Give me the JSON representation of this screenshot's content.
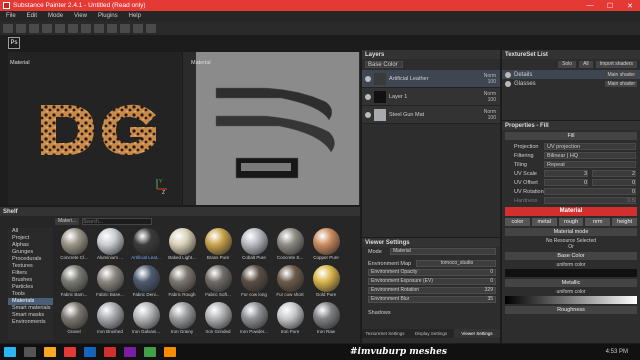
{
  "window": {
    "title": "Substance Painter 2.4.1 - Untitled (Read only)",
    "min": "—",
    "max": "☐",
    "close": "✕"
  },
  "menu": [
    "File",
    "Edit",
    "Mode",
    "View",
    "Plugins",
    "Help"
  ],
  "viewports": {
    "left_label": "Material",
    "right_label": "Material",
    "gizmo_y": "Y",
    "gizmo_z": "Z"
  },
  "layers": {
    "title": "Layers",
    "channel": "Base Color",
    "items": [
      {
        "name": "Artificial Leather",
        "blend": "Norm",
        "opacity": "100"
      },
      {
        "name": "Layer 1",
        "blend": "Norm",
        "opacity": "100"
      },
      {
        "name": "Steel Gun Mat",
        "blend": "Norm",
        "opacity": "100"
      }
    ]
  },
  "textureset": {
    "title": "TextureSet List",
    "solo": "Solo",
    "all": "All",
    "import": "Import shaders",
    "items": [
      {
        "name": "Details",
        "shader": "Main shader"
      },
      {
        "name": "Glasses",
        "shader": "Main shader"
      }
    ]
  },
  "properties": {
    "title": "Properties - Fill",
    "fill": "Fill",
    "projection_label": "Projection",
    "projection": "UV projection",
    "filtering_label": "Filtering",
    "filtering": "Bilinear | HQ",
    "tiling_label": "Tiling",
    "tiling": "Repeat",
    "uvscale_label": "UV Scale",
    "uvscale": "3",
    "uvscale2": "2",
    "uvoffset_label": "UV Offset",
    "uvoffset": "0",
    "uvoffset2": "0",
    "uvrotation_label": "UV Rotation",
    "uvrotation": "0",
    "hardness_label": "Hardness",
    "hardness": "0.5",
    "material": "Material",
    "chips": [
      "color",
      "metal",
      "rough",
      "nrm",
      "height"
    ],
    "material_mode": "Material mode",
    "no_resource": "No Resource Selected",
    "or": "Or",
    "base_color": "Base Color",
    "uniform1": "uniform color",
    "metallic": "Metallic",
    "uniform2": "uniform color",
    "roughness": "Roughness"
  },
  "shelf": {
    "title": "Shelf",
    "filter": "Materi...",
    "search_placeholder": "Search...",
    "categories": [
      "All",
      "Project",
      "Alphas",
      "Grunges",
      "Procedurals",
      "Textures",
      "Filters",
      "Brushes",
      "Particles",
      "Tools",
      "Materials",
      "Smart materials",
      "Smart masks",
      "Environments"
    ],
    "selected_category": "Materials",
    "materials": [
      {
        "name": "Concrete Cl...",
        "color": "#9a9486"
      },
      {
        "name": "Aluminium ...",
        "color": "#c9ccd0"
      },
      {
        "name": "Artificial Leat...",
        "color": "#3a3a3a"
      },
      {
        "name": "Baked Light...",
        "color": "#d8cfb6"
      },
      {
        "name": "Brass Pure",
        "color": "#c9a24a"
      },
      {
        "name": "Cobalt Pure",
        "color": "#b7b9c0"
      },
      {
        "name": "Concrete S...",
        "color": "#8d8a84"
      },
      {
        "name": "Copper Pure",
        "color": "#c98b5c"
      },
      {
        "name": "Fabric Bam...",
        "color": "#7a7a74"
      },
      {
        "name": "Fabric Base...",
        "color": "#8a8680"
      },
      {
        "name": "Fabric Deni...",
        "color": "#4e5a70"
      },
      {
        "name": "Fabric Rough",
        "color": "#7b756d"
      },
      {
        "name": "Fabric Soft...",
        "color": "#6e6a66"
      },
      {
        "name": "Fur cow long",
        "color": "#5a4e44"
      },
      {
        "name": "Fur cow short",
        "color": "#6c5a4a"
      },
      {
        "name": "Gold Pure",
        "color": "#d9b44a"
      },
      {
        "name": "Gravel",
        "color": "#7c7770"
      },
      {
        "name": "Iron Brushed",
        "color": "#a8aaae"
      },
      {
        "name": "Iron Galvani...",
        "color": "#b4b6b8"
      },
      {
        "name": "Iron Grainy",
        "color": "#9a9c9e"
      },
      {
        "name": "Iron Grinded",
        "color": "#b0b2b4"
      },
      {
        "name": "Iron Powder...",
        "color": "#8e9094"
      },
      {
        "name": "Iron Pure",
        "color": "#c6c8ca"
      },
      {
        "name": "Iron Raw",
        "color": "#7f8184"
      }
    ]
  },
  "viewer": {
    "title": "Viewer Settings",
    "mode_label": "Mode",
    "mode": "Material",
    "envmap_label": "Environment Map",
    "envmap": "tomoco_studio",
    "opacity_label": "Environment Opacity",
    "opacity": "0",
    "exposure_label": "Environment Exposure (EV)",
    "exposure": "0",
    "rotation_label": "Environment Rotation",
    "rotation": "329",
    "blur_label": "Environment Blur",
    "blur": "35",
    "shadows_label": "Shadows"
  },
  "bottom_tabs": [
    "TextureSet Settings",
    "Display Settings",
    "Viewer Settings"
  ],
  "taskbar": {
    "watermark": "#imvuburp meshes",
    "time": "4:53 PM"
  },
  "colors": {
    "title_red": "#e53935",
    "accent_red": "#d32f2f",
    "selection_blue": "#4a5e78"
  }
}
